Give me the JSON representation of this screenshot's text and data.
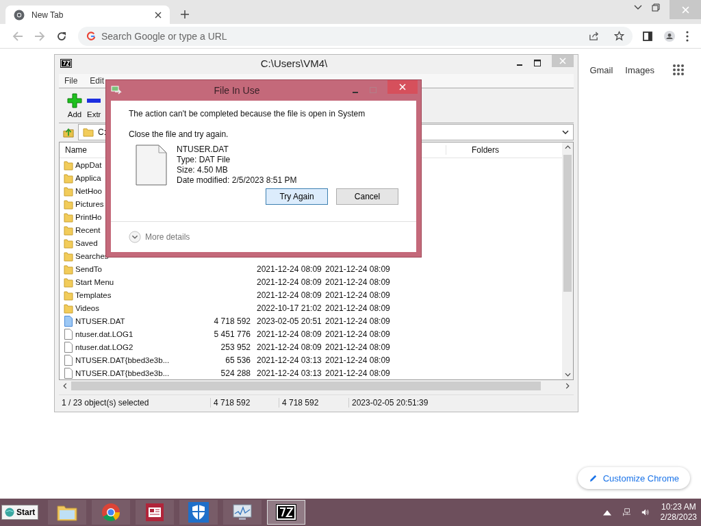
{
  "browser": {
    "tab": {
      "title": "New Tab"
    },
    "omnibox": {
      "placeholder": "Search Google or type a URL"
    },
    "links": [
      "Gmail",
      "Images"
    ],
    "customize_button": "Customize Chrome"
  },
  "archiver": {
    "title": "C:\\Users\\VM4\\",
    "menu": [
      "File",
      "Edit"
    ],
    "toolbar": [
      {
        "label": "Add",
        "kind": "add"
      },
      {
        "label": "Extr",
        "kind": "extract"
      }
    ],
    "address": "C:",
    "columns": [
      "Name",
      "Folders"
    ],
    "rows": [
      {
        "name": "AppDat",
        "kind": "folder"
      },
      {
        "name": "Applica",
        "kind": "folder"
      },
      {
        "name": "NetHoo",
        "kind": "folder"
      },
      {
        "name": "Pictures",
        "kind": "folder"
      },
      {
        "name": "PrintHo",
        "kind": "folder"
      },
      {
        "name": "Recent",
        "kind": "folder"
      },
      {
        "name": "Saved",
        "kind": "folder"
      },
      {
        "name": "Searches",
        "kind": "folder"
      },
      {
        "name": "SendTo",
        "kind": "folder",
        "modified": "2021-12-24 08:09",
        "created": "2021-12-24 08:09"
      },
      {
        "name": "Start Menu",
        "kind": "folder",
        "modified": "2021-12-24 08:09",
        "created": "2021-12-24 08:09"
      },
      {
        "name": "Templates",
        "kind": "folder",
        "modified": "2021-12-24 08:09",
        "created": "2021-12-24 08:09"
      },
      {
        "name": "Videos",
        "kind": "folder",
        "modified": "2022-10-17 21:02",
        "created": "2021-12-24 08:09"
      },
      {
        "name": "NTUSER.DAT",
        "kind": "datafile",
        "size": "4 718 592",
        "modified": "2023-02-05 20:51",
        "created": "2021-12-24 08:09"
      },
      {
        "name": "ntuser.dat.LOG1",
        "kind": "file",
        "size": "5 451 776",
        "modified": "2021-12-24 08:09",
        "created": "2021-12-24 08:09"
      },
      {
        "name": "ntuser.dat.LOG2",
        "kind": "file",
        "size": "253 952",
        "modified": "2021-12-24 08:09",
        "created": "2021-12-24 08:09"
      },
      {
        "name": "NTUSER.DAT{bbed3e3b...",
        "kind": "file",
        "size": "65 536",
        "modified": "2021-12-24 03:13",
        "created": "2021-12-24 08:09"
      },
      {
        "name": "NTUSER.DAT{bbed3e3b...",
        "kind": "file",
        "size": "524 288",
        "modified": "2021-12-24 03:13",
        "created": "2021-12-24 08:09"
      }
    ],
    "status": [
      "1 / 23 object(s) selected",
      "4 718 592",
      "4 718 592",
      "2023-02-05 20:51:39"
    ]
  },
  "dialog": {
    "title": "File In Use",
    "message": "The action can't be completed because the file is open in System",
    "instruction": "Close the file and try again.",
    "file": [
      "NTUSER.DAT",
      "Type: DAT File",
      "Size: 4.50 MB",
      "Date modified: 2/5/2023 8:51 PM"
    ],
    "buttons": [
      {
        "label": "Try Again",
        "default": true
      },
      {
        "label": "Cancel",
        "default": false
      }
    ],
    "details": "More details"
  },
  "taskbar": {
    "start": "Start",
    "apps": [
      {
        "kind": "explorer",
        "active": false
      },
      {
        "kind": "chrome",
        "active": false
      },
      {
        "kind": "news",
        "active": false
      },
      {
        "kind": "shield",
        "active": false
      },
      {
        "kind": "monitor",
        "active": false
      },
      {
        "kind": "sevenzip",
        "active": true
      }
    ],
    "time": "10:23 AM",
    "date": "2/28/2023"
  }
}
